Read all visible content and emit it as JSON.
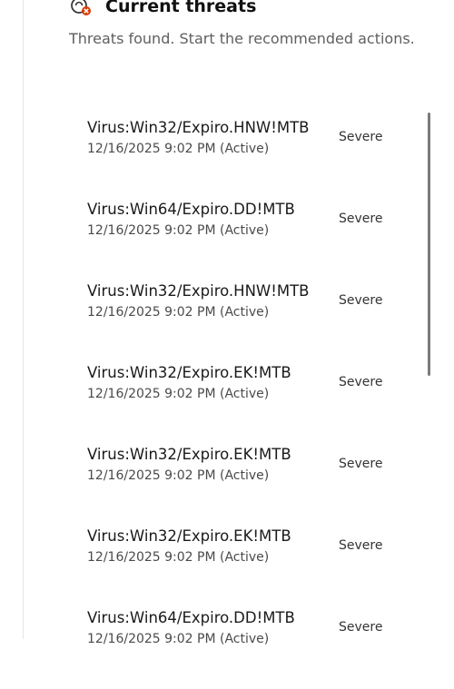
{
  "header": {
    "title": "Current threats",
    "subtitle": "Threats found. Start the recommended actions.",
    "icon": "shield-alert-icon",
    "icon_color": "#d83b01"
  },
  "threats": [
    {
      "name": "Virus:Win32/Expiro.HNW!MTB",
      "timestamp": "12/16/2025 9:02 PM (Active)",
      "severity": "Severe"
    },
    {
      "name": "Virus:Win64/Expiro.DD!MTB",
      "timestamp": "12/16/2025 9:02 PM (Active)",
      "severity": "Severe"
    },
    {
      "name": "Virus:Win32/Expiro.HNW!MTB",
      "timestamp": "12/16/2025 9:02 PM (Active)",
      "severity": "Severe"
    },
    {
      "name": "Virus:Win32/Expiro.EK!MTB",
      "timestamp": "12/16/2025 9:02 PM (Active)",
      "severity": "Severe"
    },
    {
      "name": "Virus:Win32/Expiro.EK!MTB",
      "timestamp": "12/16/2025 9:02 PM (Active)",
      "severity": "Severe"
    },
    {
      "name": "Virus:Win32/Expiro.EK!MTB",
      "timestamp": "12/16/2025 9:02 PM (Active)",
      "severity": "Severe"
    },
    {
      "name": "Virus:Win64/Expiro.DD!MTB",
      "timestamp": "12/16/2025 9:02 PM (Active)",
      "severity": "Severe"
    }
  ]
}
